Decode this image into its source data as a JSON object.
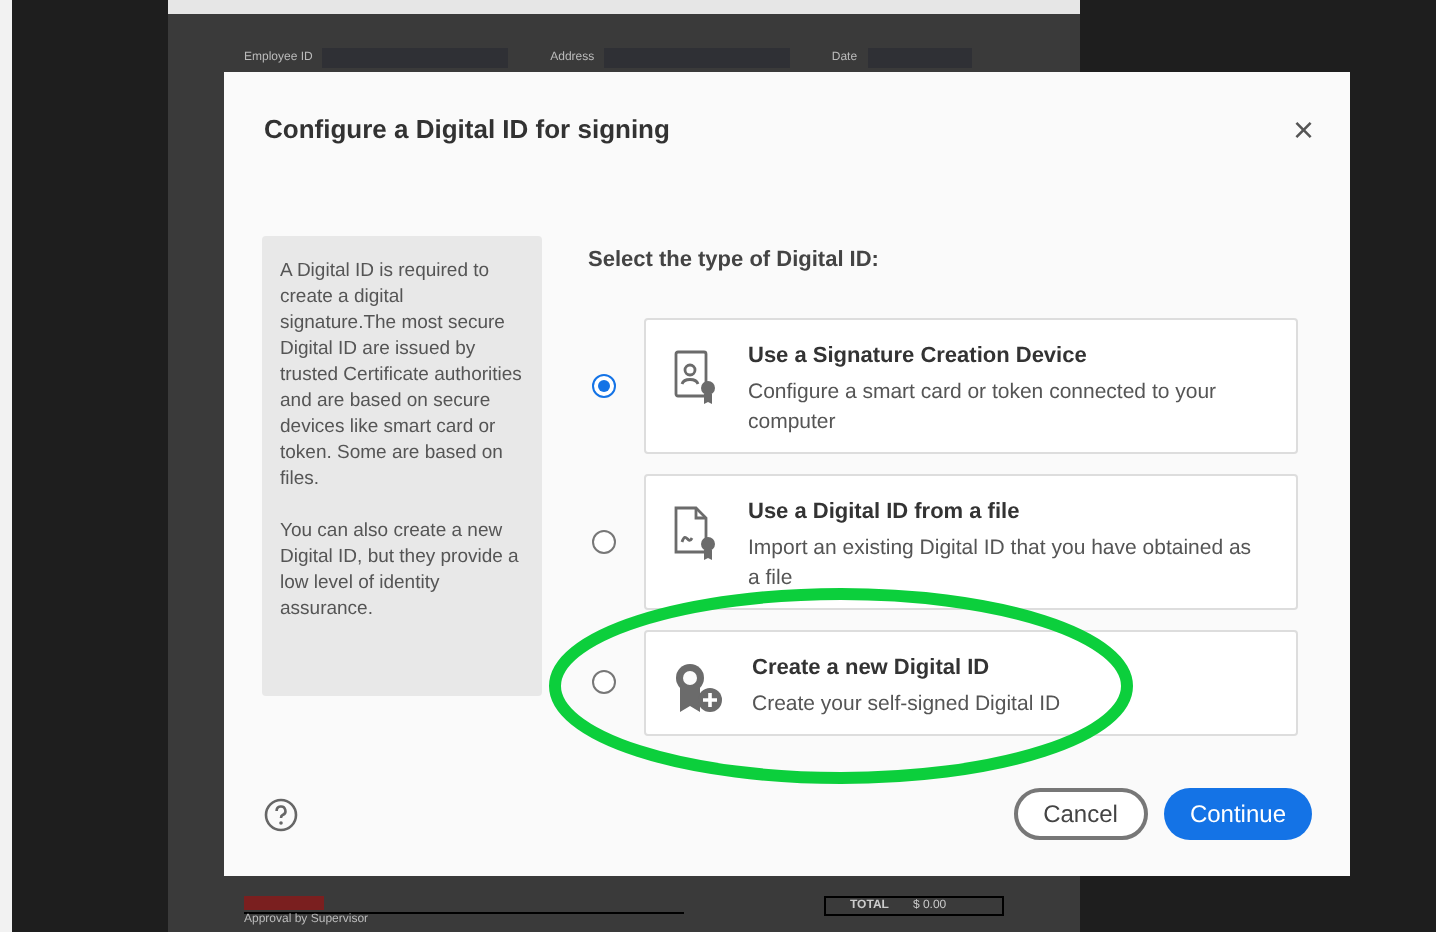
{
  "document": {
    "fields": [
      "Employee ID",
      "Address",
      "Date"
    ],
    "total_label": "TOTAL",
    "total_value": "$ 0.00",
    "approval": "Approval by Supervisor"
  },
  "dialog": {
    "title": "Configure a Digital ID for signing",
    "close": "×",
    "info": [
      "A Digital ID is required to create a digital signature.The most secure Digital ID are issued by trusted Certificate authorities and are based on secure devices like smart card or token. Some are based on files.",
      "You can also create a new Digital ID, but they provide a low level of identity assurance."
    ],
    "prompt": "Select the type of Digital ID:",
    "options": [
      {
        "kind": "device",
        "title": "Use a Signature Creation Device",
        "description": "Configure a smart card or token connected to your computer",
        "selected": true,
        "highlighted": false
      },
      {
        "kind": "file",
        "title": "Use a Digital ID from a file",
        "description": "Import an existing Digital ID that you have obtained as a file",
        "selected": false,
        "highlighted": false
      },
      {
        "kind": "new",
        "title": "Create a new Digital ID",
        "description": "Create your self-signed Digital ID",
        "selected": false,
        "highlighted": true
      }
    ],
    "buttons": [
      {
        "kind": "secondary",
        "label": "Cancel"
      },
      {
        "kind": "primary",
        "label": "Continue"
      }
    ]
  }
}
